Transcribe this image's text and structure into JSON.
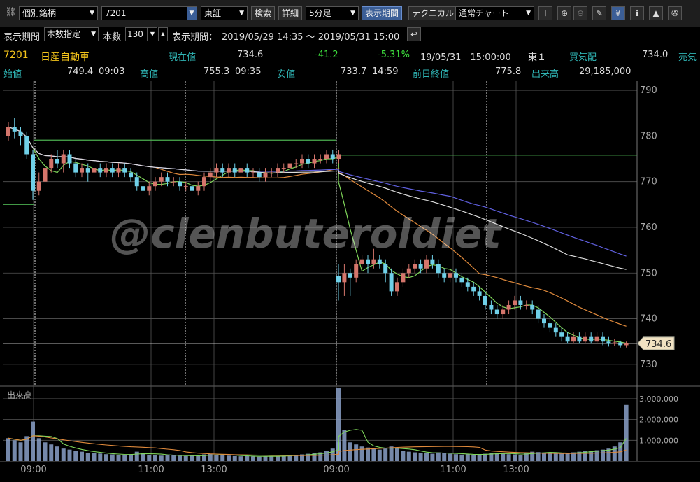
{
  "toolbar": {
    "link_icon": "link-icon",
    "mode_select": "個別銘柄",
    "code_input": "7201",
    "market_select": "東証",
    "search_button": "検索",
    "detail_button": "詳細",
    "interval_select": "5分足",
    "period_button": "表示期間",
    "technical_button": "テクニカル",
    "chart_type_select": "通常チャート",
    "icons": [
      "crosshair-icon",
      "zoom-in-icon",
      "zoom-out-icon",
      "pencil-icon",
      "yen-icon",
      "info-icon",
      "area-chart-icon",
      "wrench-icon"
    ]
  },
  "periodbar": {
    "label": "表示期間",
    "mode_select": "本数指定",
    "count_label": "本数",
    "count_value": "130",
    "range_label": "表示期間：",
    "range_value": "2019/05/29 14:35 ～ 2019/05/31 15:00",
    "back_icon": "return-icon"
  },
  "quote": {
    "code": "7201",
    "name": "日産自動車",
    "current_label": "現在値",
    "current_value": "734.6",
    "change": "-41.2",
    "change_pct": "-5.31%",
    "datetime": "19/05/31　15:00:00",
    "market": "東１",
    "bid_label": "買気配",
    "bid_value": "734.0",
    "ask_label": "売気",
    "open_label": "始値",
    "open_value": "749.4",
    "open_time": "09:03",
    "high_label": "高値",
    "high_value": "755.3",
    "high_time": "09:35",
    "low_label": "安値",
    "low_value": "733.7",
    "low_time": "14:59",
    "prev_close_label": "前日終値",
    "prev_close_value": "775.8",
    "volume_label": "出来高",
    "volume_value": "29,185,000"
  },
  "colors": {
    "up": "#d4756b",
    "down": "#6fd0e8",
    "ma_short": "#7fd65a",
    "ma_mid": "#e08a3c",
    "ma_long": "#6060e0",
    "vwap": "#dddddd",
    "grid": "#555555",
    "axis_text": "#aaaaaa",
    "volume": "#8aa0c8"
  },
  "chart_data": [
    {
      "type": "candlestick",
      "ylim": [
        726,
        792
      ],
      "yticks": [
        730,
        740,
        750,
        760,
        770,
        780,
        790
      ],
      "xticks": [
        "09:00",
        "11:00",
        "13:00",
        "09:00",
        "11:00",
        "13:00"
      ],
      "last_price_label": "734.6",
      "watermark": "@clenbuteroldiet",
      "reference_lines": [
        {
          "name": "prev_close_day1",
          "value": 779.1
        },
        {
          "name": "prev_close_day2",
          "value": 775.8
        },
        {
          "name": "prev_close_day0",
          "value": 765.0
        },
        {
          "name": "last_price",
          "value": 734.6
        }
      ],
      "candles": {
        "day1": [
          [
            780,
            782,
            783,
            779
          ],
          [
            782,
            781,
            784,
            779.5
          ],
          [
            781,
            780,
            782,
            778
          ],
          [
            780,
            776,
            781,
            775
          ],
          [
            776,
            768,
            777,
            766
          ],
          [
            768,
            770,
            772,
            767
          ],
          [
            770,
            773,
            774,
            769
          ],
          [
            773,
            775,
            776,
            772
          ],
          [
            775,
            774,
            777,
            773
          ],
          [
            774,
            776,
            777,
            772
          ],
          [
            776,
            774,
            777,
            773
          ],
          [
            774,
            772,
            775,
            771
          ],
          [
            772,
            773,
            774,
            771
          ],
          [
            773,
            772,
            774,
            770
          ],
          [
            772,
            773,
            774,
            771
          ],
          [
            773,
            772,
            774,
            771
          ],
          [
            772,
            773,
            774,
            771
          ],
          [
            773,
            772,
            774,
            771
          ],
          [
            772,
            773,
            774,
            771
          ],
          [
            773,
            772,
            774,
            771
          ],
          [
            772,
            771,
            773,
            770
          ],
          [
            771,
            769,
            772,
            768
          ],
          [
            769,
            768,
            770,
            767
          ],
          [
            768,
            769,
            770,
            767
          ],
          [
            769,
            770,
            771,
            768
          ],
          [
            770,
            771,
            772,
            769
          ],
          [
            771,
            770,
            772,
            769
          ],
          [
            770,
            770,
            771,
            769
          ],
          [
            770,
            769,
            771,
            768
          ],
          [
            769,
            769,
            770,
            768
          ],
          [
            769,
            768,
            770,
            767
          ],
          [
            768,
            769,
            770,
            767
          ],
          [
            769,
            771,
            772,
            768
          ],
          [
            771,
            772,
            773,
            770
          ],
          [
            772,
            773,
            774,
            771
          ],
          [
            773,
            772,
            774,
            771
          ],
          [
            772,
            773,
            774,
            771
          ],
          [
            773,
            772,
            774,
            771
          ],
          [
            772,
            773,
            774,
            771
          ],
          [
            773,
            772,
            774,
            771
          ],
          [
            772,
            772,
            773,
            771
          ],
          [
            772,
            771,
            773,
            770
          ],
          [
            771,
            772,
            773,
            770
          ],
          [
            772,
            772,
            773,
            771
          ],
          [
            772,
            773,
            774,
            771
          ],
          [
            773,
            773,
            774,
            772
          ],
          [
            773,
            774,
            775,
            772
          ],
          [
            774,
            774,
            775,
            773
          ],
          [
            774,
            775,
            776,
            773
          ],
          [
            775,
            774,
            776,
            773
          ],
          [
            774,
            775,
            776,
            773
          ],
          [
            775,
            775,
            776,
            774
          ],
          [
            775,
            776,
            777,
            774
          ],
          [
            776,
            775,
            777,
            774
          ],
          [
            775,
            776,
            777,
            774
          ]
        ],
        "day2": [
          [
            749.4,
            748,
            752,
            744
          ],
          [
            748,
            750,
            752,
            745
          ],
          [
            750,
            749,
            751,
            745
          ],
          [
            749,
            752,
            753,
            748
          ],
          [
            752,
            753,
            754,
            751
          ],
          [
            753,
            752,
            754,
            750
          ],
          [
            752,
            753,
            755.3,
            751
          ],
          [
            753,
            752,
            754,
            751
          ],
          [
            752,
            750,
            753,
            748
          ],
          [
            750,
            746,
            751,
            745
          ],
          [
            746,
            748,
            749,
            745
          ],
          [
            748,
            750,
            751,
            747
          ],
          [
            750,
            751,
            752,
            749
          ],
          [
            751,
            752,
            753,
            750
          ],
          [
            752,
            751,
            753,
            750
          ],
          [
            751,
            753,
            754,
            750
          ],
          [
            753,
            752,
            754,
            751
          ],
          [
            752,
            750,
            753,
            749
          ],
          [
            750,
            749,
            751,
            748
          ],
          [
            749,
            750,
            751,
            748
          ],
          [
            750,
            749,
            751,
            748
          ],
          [
            749,
            748,
            750,
            747
          ],
          [
            748,
            747,
            749,
            746
          ],
          [
            747,
            746,
            748,
            745
          ],
          [
            746,
            745,
            747,
            744
          ],
          [
            745,
            743,
            746,
            742
          ],
          [
            743,
            742,
            744,
            741
          ],
          [
            742,
            741,
            743,
            740
          ],
          [
            741,
            742,
            743,
            740
          ],
          [
            742,
            743,
            744,
            741
          ],
          [
            743,
            744,
            745,
            742
          ],
          [
            744,
            743,
            745,
            742
          ],
          [
            743,
            743,
            744,
            742
          ],
          [
            743,
            742,
            744,
            741
          ],
          [
            742,
            740,
            743,
            739
          ],
          [
            740,
            739,
            741,
            738
          ],
          [
            739,
            738,
            740,
            737
          ],
          [
            738,
            737,
            739,
            736
          ],
          [
            737,
            736,
            738,
            735
          ],
          [
            736,
            735,
            737,
            734.5
          ],
          [
            735,
            736,
            737,
            734.5
          ],
          [
            736,
            735,
            737,
            734.5
          ],
          [
            735,
            736,
            737,
            734.5
          ],
          [
            736,
            735,
            737,
            734.5
          ],
          [
            735,
            736,
            737,
            734.5
          ],
          [
            736,
            735,
            737,
            734.2
          ],
          [
            735,
            734.5,
            736,
            733.9
          ],
          [
            734.5,
            734.8,
            735.5,
            734
          ],
          [
            734.8,
            734.2,
            735.2,
            733.7
          ],
          [
            734.2,
            734.6,
            735,
            733.7
          ]
        ]
      },
      "moving_averages": [
        "ma_short",
        "ma_mid",
        "ma_long",
        "vwap"
      ]
    },
    {
      "type": "bar",
      "title": "出来高",
      "ylim": [
        0,
        3400000
      ],
      "yticks": [
        1000000,
        2000000,
        3000000
      ],
      "ytick_labels": [
        "1,000,000",
        "2,000,000",
        "3,000,000"
      ],
      "volume_day1": [
        1100000,
        1000000,
        900000,
        1200000,
        1900000,
        1100000,
        900000,
        800000,
        700000,
        600000,
        550000,
        500000,
        450000,
        400000,
        380000,
        360000,
        330000,
        320000,
        300000,
        290000,
        330000,
        450000,
        380000,
        300000,
        280000,
        260000,
        300000,
        270000,
        250000,
        240000,
        260000,
        240000,
        320000,
        350000,
        300000,
        280000,
        260000,
        240000,
        230000,
        250000,
        220000,
        210000,
        230000,
        250000,
        240000,
        260000,
        280000,
        300000,
        320000,
        350000,
        380000,
        420000,
        480000,
        600000,
        900000
      ],
      "volume_day2": [
        3500000,
        1500000,
        900000,
        800000,
        700000,
        650000,
        600000,
        550000,
        600000,
        700000,
        650000,
        500000,
        450000,
        420000,
        400000,
        380000,
        350000,
        420000,
        380000,
        350000,
        330000,
        310000,
        330000,
        300000,
        320000,
        350000,
        400000,
        380000,
        350000,
        330000,
        320000,
        300000,
        400000,
        450000,
        430000,
        410000,
        390000,
        380000,
        360000,
        400000,
        420000,
        450000,
        480000,
        500000,
        520000,
        550000,
        600000,
        700000,
        900000,
        2700000
      ]
    }
  ]
}
